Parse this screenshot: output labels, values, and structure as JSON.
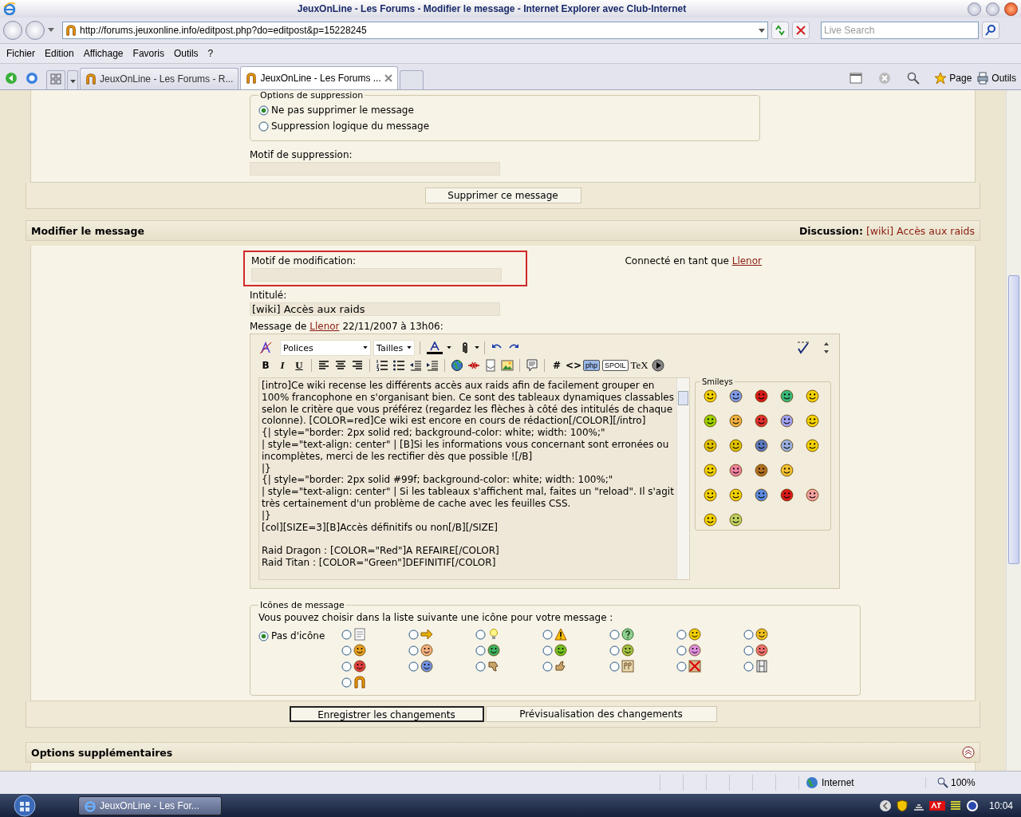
{
  "window": {
    "title": "JeuxOnLine - Les Forums - Modifier le message - Internet Explorer avec Club-Internet"
  },
  "address_bar": {
    "url": "http://forums.jeuxonline.info/editpost.php?do=editpost&p=15228245",
    "search_placeholder": "Live Search"
  },
  "menu": [
    "Fichier",
    "Edition",
    "Affichage",
    "Favoris",
    "Outils",
    "?"
  ],
  "tabs": [
    {
      "label": "JeuxOnLine - Les Forums - R...",
      "selected": false
    },
    {
      "label": "JeuxOnLine - Les Forums ...",
      "selected": true
    }
  ],
  "command_bar": [
    "Page",
    "Outils"
  ],
  "delete_section": {
    "legend": "Options de suppression",
    "options": [
      {
        "label": "Ne pas supprimer le message",
        "selected": true
      },
      {
        "label": "Suppression logique du message",
        "selected": false
      }
    ],
    "reason_label": "Motif de suppression:",
    "button": "Supprimer ce message"
  },
  "edit_section": {
    "title": "Modifier le message",
    "discussion_label": "Discussion:",
    "discussion_link": "[wiki] Accès aux raids",
    "reason_label": "Motif de modification:",
    "reason_highlighted": true,
    "logged_in_text": "Connecté en tant que",
    "logged_in_user": "Llenor",
    "subject_label": "Intitulé:",
    "subject_value": "[wiki] Accès aux raids",
    "message_prefix": "Message de",
    "message_author": "Llenor",
    "message_date": "22/11/2007 à 13h06:",
    "editor": {
      "font_select": "Polices",
      "size_select": "Tailles",
      "toolbar": [
        {
          "kind": "bold",
          "label": "B"
        },
        {
          "kind": "italic",
          "label": "I"
        },
        {
          "kind": "underline",
          "label": "U"
        },
        {
          "kind": "sep"
        },
        {
          "kind": "align-left"
        },
        {
          "kind": "align-center"
        },
        {
          "kind": "align-right"
        },
        {
          "kind": "sep"
        },
        {
          "kind": "list-ordered"
        },
        {
          "kind": "list-bullet"
        },
        {
          "kind": "outdent"
        },
        {
          "kind": "indent"
        },
        {
          "kind": "sep"
        },
        {
          "kind": "globe"
        },
        {
          "kind": "unlink"
        },
        {
          "kind": "attach"
        },
        {
          "kind": "image"
        },
        {
          "kind": "sep"
        },
        {
          "kind": "quote"
        },
        {
          "kind": "sep"
        },
        {
          "kind": "hash",
          "label": "#"
        },
        {
          "kind": "code",
          "label": "<>"
        },
        {
          "kind": "php",
          "label": "php"
        },
        {
          "kind": "spoil",
          "label": "SPOIL"
        },
        {
          "kind": "tex",
          "label": "TeX"
        },
        {
          "kind": "video"
        }
      ],
      "text": "[intro]Ce wiki recense les différents accès aux raids afin de facilement grouper en 100% francophone en s'organisant bien. Ce sont des tableaux dynamiques classables selon le critère que vous préférez (regardez les flèches à côté des intitulés de chaque colonne). [COLOR=red]Ce wiki est encore en cours de rédaction[/COLOR][/intro]\n{| style=\"border: 2px solid red; background-color: white; width: 100%;\"\n| style=\"text-align: center\" | [B]Si les informations vous concernant sont erronées ou incomplètes, merci de les rectifier dès que possible ![/B]\n|}\n{| style=\"border: 2px solid #99f; background-color: white; width: 100%;\"\n| style=\"text-align: center\" | Si les tableaux s'affichent mal, faites un \"reload\". Il s'agit très certainement d'un problème de cache avec les feuilles CSS.\n|}\n[col][SIZE=3][B]Accès définitifs ou non[/B][/SIZE]\n\nRaid Dragon : [COLOR=\"Red\"]A REFAIRE[/COLOR]\nRaid Titan : [COLOR=\"Green\"]DEFINITIF[/COLOR]",
      "smileys_title": "Smileys"
    },
    "icons": {
      "legend": "Icônes de message",
      "hint": "Vous pouvez choisir dans la liste suivante une icône pour votre message :",
      "none_label": "Pas d'icône",
      "none_selected": true,
      "options": [
        {
          "kind": "document",
          "selected": false
        },
        {
          "kind": "arrow",
          "selected": false
        },
        {
          "kind": "bulb",
          "selected": false
        },
        {
          "kind": "warning",
          "selected": false
        },
        {
          "kind": "question",
          "selected": false
        },
        {
          "kind": "face",
          "color": "#f2d000",
          "selected": false
        },
        {
          "kind": "face",
          "color": "#f0c020",
          "selected": false
        },
        {
          "kind": "face",
          "color": "#e8a020",
          "selected": false
        },
        {
          "kind": "face",
          "color": "#f4b080",
          "selected": false
        },
        {
          "kind": "face",
          "color": "#40b060",
          "selected": false
        },
        {
          "kind": "face",
          "color": "#70c020",
          "selected": false
        },
        {
          "kind": "face",
          "color": "#a0c040",
          "selected": false
        },
        {
          "kind": "face",
          "color": "#e090e0",
          "selected": false
        },
        {
          "kind": "face",
          "color": "#f07070",
          "selected": false
        },
        {
          "kind": "face",
          "color": "#e04040",
          "selected": false
        },
        {
          "kind": "face",
          "color": "#7090e0",
          "selected": false
        },
        {
          "kind": "thumbs-down",
          "selected": false
        },
        {
          "kind": "thumbs-up",
          "selected": false
        },
        {
          "kind": "rp",
          "selected": false
        },
        {
          "kind": "cross",
          "selected": false
        },
        {
          "kind": "film",
          "selected": false
        },
        {
          "kind": "logo",
          "selected": false
        }
      ]
    }
  },
  "buttons": [
    "Enregistrer les changements",
    "Prévisualisation des changements"
  ],
  "extra_section": {
    "title": "Options supplémentaires"
  },
  "status_bar": {
    "zone": "Internet",
    "zoom": "100%"
  },
  "taskbar": {
    "window": "JeuxOnLine - Les For...",
    "clock": "10:04"
  }
}
